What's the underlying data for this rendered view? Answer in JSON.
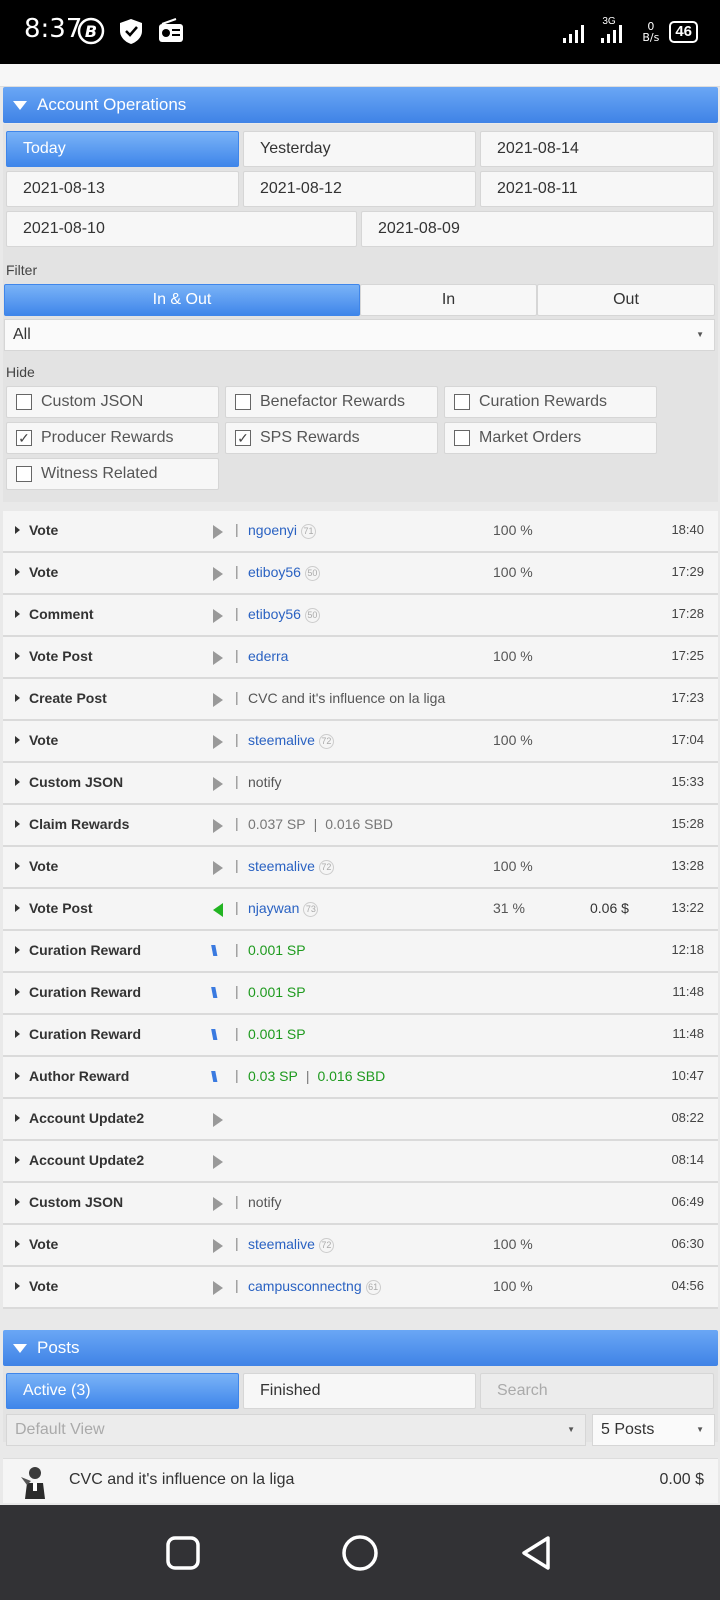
{
  "status_bar": {
    "time": "8:37",
    "net_top": "0",
    "net_unit": "B/s",
    "signal_label": "3G",
    "battery": "46"
  },
  "account_ops": {
    "title": "Account Operations",
    "dates": [
      "Today",
      "Yesterday",
      "2021-08-14",
      "2021-08-13",
      "2021-08-12",
      "2021-08-11",
      "2021-08-10",
      "2021-08-09"
    ],
    "filter_label": "Filter",
    "filter_tabs": [
      "In & Out",
      "In",
      "Out"
    ],
    "filter_select": "All",
    "hide_label": "Hide",
    "hide_options": [
      {
        "label": "Custom JSON",
        "checked": false
      },
      {
        "label": "Benefactor Rewards",
        "checked": false
      },
      {
        "label": "Curation Rewards",
        "checked": false
      },
      {
        "label": "Producer Rewards",
        "checked": true
      },
      {
        "label": "SPS Rewards",
        "checked": true
      },
      {
        "label": "Market Orders",
        "checked": false
      },
      {
        "label": "Witness Related",
        "checked": false
      }
    ],
    "check_mark": "✓"
  },
  "operations": [
    {
      "name": "Vote",
      "icon": "gray-arrow",
      "user": "ngoenyi",
      "rep": "71",
      "pct": "100 %",
      "time": "18:40"
    },
    {
      "name": "Vote",
      "icon": "gray-arrow",
      "user": "etiboy56",
      "rep": "50",
      "pct": "100 %",
      "time": "17:29"
    },
    {
      "name": "Comment",
      "icon": "gray-arrow",
      "user": "etiboy56",
      "rep": "50",
      "time": "17:28"
    },
    {
      "name": "Vote Post",
      "icon": "gray-arrow",
      "user": "ederra",
      "pct": "100 %",
      "time": "17:25"
    },
    {
      "name": "Create Post",
      "icon": "gray-arrow",
      "text": "CVC and it's influence on la liga",
      "time": "17:23"
    },
    {
      "name": "Vote",
      "icon": "gray-arrow",
      "user": "steemalive",
      "rep": "72",
      "pct": "100 %",
      "time": "17:04"
    },
    {
      "name": "Custom JSON",
      "icon": "gray-arrow",
      "text": "notify",
      "time": "15:33"
    },
    {
      "name": "Claim Rewards",
      "icon": "gray-arrow",
      "gray1": "0.037 SP",
      "gray2": "0.016 SBD",
      "time": "15:28"
    },
    {
      "name": "Vote",
      "icon": "gray-arrow",
      "user": "steemalive",
      "rep": "72",
      "pct": "100 %",
      "time": "13:28"
    },
    {
      "name": "Vote Post",
      "icon": "green-arrow",
      "user": "njaywan",
      "rep": "73",
      "pct": "31 %",
      "amount": "0.06 $",
      "time": "13:22"
    },
    {
      "name": "Curation Reward",
      "icon": "steem",
      "green1": "0.001 SP",
      "time": "12:18"
    },
    {
      "name": "Curation Reward",
      "icon": "steem",
      "green1": "0.001 SP",
      "time": "11:48"
    },
    {
      "name": "Curation Reward",
      "icon": "steem",
      "green1": "0.001 SP",
      "time": "11:48"
    },
    {
      "name": "Author Reward",
      "icon": "steem",
      "green1": "0.03 SP",
      "green2": "0.016 SBD",
      "time": "10:47"
    },
    {
      "name": "Account Update2",
      "icon": "gray-arrow",
      "time": "08:22"
    },
    {
      "name": "Account Update2",
      "icon": "gray-arrow",
      "time": "08:14"
    },
    {
      "name": "Custom JSON",
      "icon": "gray-arrow",
      "text": "notify",
      "time": "06:49"
    },
    {
      "name": "Vote",
      "icon": "gray-arrow",
      "user": "steemalive",
      "rep": "72",
      "pct": "100 %",
      "time": "06:30"
    },
    {
      "name": "Vote",
      "icon": "gray-arrow",
      "user": "campusconnectng",
      "rep": "61",
      "pct": "100 %",
      "time": "04:56"
    }
  ],
  "posts": {
    "title": "Posts",
    "tabs": [
      "Active (3)",
      "Finished"
    ],
    "search_placeholder": "Search",
    "view_select": "Default View",
    "count_select": "5 Posts",
    "items": [
      {
        "title": "CVC and it's influence on la liga",
        "amount": "0.00 $"
      }
    ]
  },
  "separator": "|",
  "colors": {
    "accent": "#3f86ea",
    "link": "#2a62c2",
    "reward_green": "#1e9a1e",
    "nav_bg": "#323235"
  }
}
